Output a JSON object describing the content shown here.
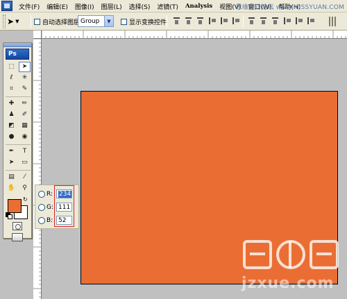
{
  "menubar": {
    "items": [
      {
        "label": "文件(F)"
      },
      {
        "label": "编辑(E)"
      },
      {
        "label": "图像(I)"
      },
      {
        "label": "图层(L)"
      },
      {
        "label": "选择(S)"
      },
      {
        "label": "滤镜(T)"
      },
      {
        "label": "Analysis"
      },
      {
        "label": "视图(V)"
      },
      {
        "label": "窗口(W)"
      },
      {
        "label": "帮助(H)"
      }
    ],
    "watermark": "思缘设计论坛 www.MISSYUAN.COM"
  },
  "options": {
    "auto_select_label": "自动选择图层",
    "auto_select_checked": false,
    "group_value": "Group",
    "show_transform_label": "显示变换控件",
    "show_transform_checked": false
  },
  "toolbox": {
    "logo": "Ps",
    "tools": [
      {
        "name": "marquee-tool-icon",
        "glyph": "⬚"
      },
      {
        "name": "move-tool-icon",
        "glyph": "➤"
      },
      {
        "name": "lasso-tool-icon",
        "glyph": "ℓ"
      },
      {
        "name": "magic-wand-tool-icon",
        "glyph": "✳"
      },
      {
        "name": "crop-tool-icon",
        "glyph": "⌗"
      },
      {
        "name": "slice-tool-icon",
        "glyph": "✎"
      },
      {
        "name": "healing-brush-tool-icon",
        "glyph": "✚"
      },
      {
        "name": "brush-tool-icon",
        "glyph": "✏"
      },
      {
        "name": "clone-stamp-tool-icon",
        "glyph": "♟"
      },
      {
        "name": "history-brush-tool-icon",
        "glyph": "✐"
      },
      {
        "name": "eraser-tool-icon",
        "glyph": "◩"
      },
      {
        "name": "gradient-tool-icon",
        "glyph": "▦"
      },
      {
        "name": "blur-tool-icon",
        "glyph": "●"
      },
      {
        "name": "dodge-tool-icon",
        "glyph": "◉"
      },
      {
        "name": "pen-tool-icon",
        "glyph": "✒"
      },
      {
        "name": "type-tool-icon",
        "glyph": "T"
      },
      {
        "name": "path-selection-tool-icon",
        "glyph": "➤"
      },
      {
        "name": "shape-tool-icon",
        "glyph": "▭"
      },
      {
        "name": "notes-tool-icon",
        "glyph": "▤"
      },
      {
        "name": "eyedropper-tool-icon",
        "glyph": "⁄"
      },
      {
        "name": "hand-tool-icon",
        "glyph": "✋"
      },
      {
        "name": "zoom-tool-icon",
        "glyph": "⚲"
      }
    ],
    "foreground_color": "#ea6e34",
    "background_color": "#ffffff"
  },
  "canvas": {
    "fill_color": "#ea6e34"
  },
  "rgb_panel": {
    "r_label": "R:",
    "g_label": "G:",
    "b_label": "B:",
    "r_value": "234",
    "g_value": "111",
    "b_value": "52",
    "highlight_color": "#e02020"
  },
  "watermark": {
    "url": "jzxue.com",
    "logo": "建站学"
  }
}
